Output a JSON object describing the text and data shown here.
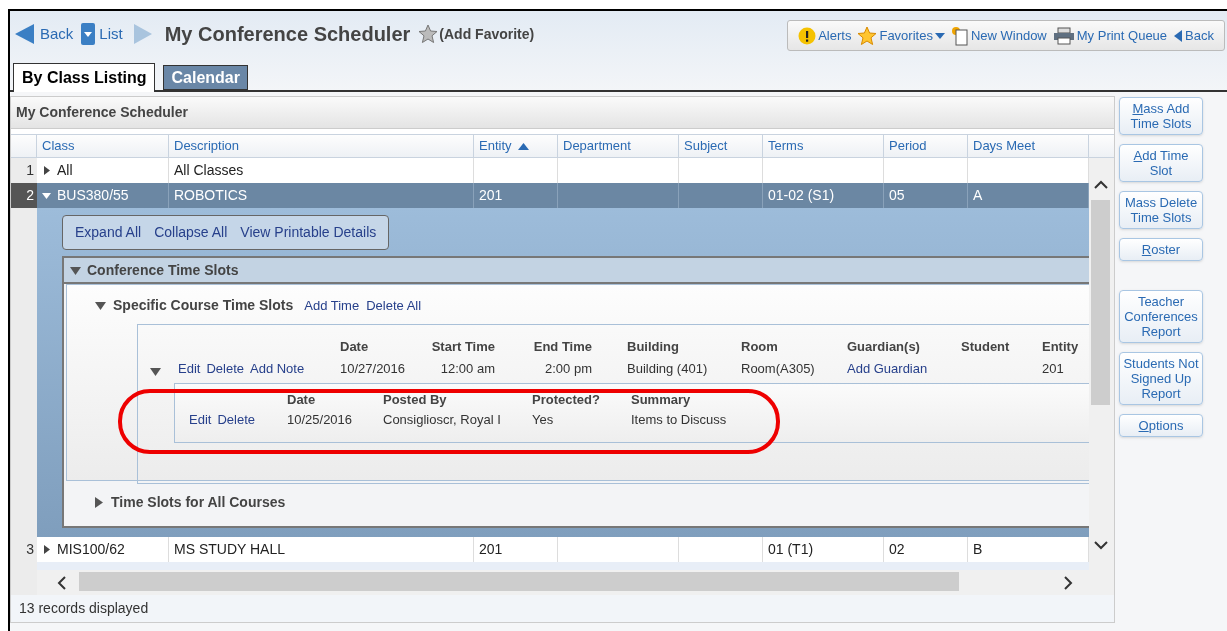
{
  "nav": {
    "back": "Back",
    "list": "List",
    "title": "My Conference Scheduler",
    "favorite": "(Add Favorite)"
  },
  "toolbar": [
    {
      "kind": "alert",
      "label": "Alerts"
    },
    {
      "kind": "favorites",
      "label": "Favorites"
    },
    {
      "kind": "new_window",
      "label": "New Window"
    },
    {
      "kind": "print",
      "label": "My Print Queue"
    },
    {
      "kind": "back",
      "label": "Back"
    }
  ],
  "tabs": [
    {
      "label": "By Class Listing",
      "selected": true
    },
    {
      "label": "Calendar",
      "selected": false
    }
  ],
  "panel_title": "My Conference Scheduler",
  "table": {
    "columns": [
      {
        "label": "Class",
        "sorted": false
      },
      {
        "label": "Description",
        "sorted": false
      },
      {
        "label": "Entity",
        "sorted": true
      },
      {
        "label": "Department",
        "sorted": false
      },
      {
        "label": "Subject",
        "sorted": false
      },
      {
        "label": "Terms",
        "sorted": false
      },
      {
        "label": "Period",
        "sorted": false
      },
      {
        "label": "Days Meet",
        "sorted": false
      }
    ],
    "rows": [
      {
        "number": "1",
        "cells": [
          "All",
          "All Classes",
          "",
          "",
          "",
          "",
          "",
          ""
        ],
        "expanded": false,
        "selected": false
      },
      {
        "number": "2",
        "cells": [
          "BUS380/55",
          "ROBOTICS",
          "201",
          "",
          "",
          "01-02 (S1)",
          "05",
          "A"
        ],
        "expanded": true,
        "selected": true
      },
      {
        "number": "3",
        "cells": [
          "MIS100/62",
          "MS STUDY HALL",
          "201",
          "",
          "",
          "01 (T1)",
          "02",
          "B"
        ],
        "expanded": false,
        "selected": false
      }
    ]
  },
  "detail": {
    "actions": [
      "Expand All",
      "Collapse All",
      "View Printable Details"
    ],
    "section": {
      "title": "Conference Time Slots",
      "expanded": true
    },
    "specific": {
      "title": "Specific Course Time Slots",
      "expanded": true,
      "links": [
        "Add Time",
        "Delete All"
      ],
      "columns": [
        "Date",
        "Start Time",
        "End Time",
        "Building",
        "Room",
        "Guardian(s)",
        "Student",
        "Entity"
      ],
      "slot": {
        "expanded": true,
        "actions": [
          "Edit",
          "Delete",
          "Add Note"
        ],
        "date": "10/27/2016",
        "start": "12:00 am",
        "end": "2:00 pm",
        "building": "Building (401)",
        "room": "Room(A305)",
        "guardian": "Add Guardian",
        "entity": "201"
      },
      "note": {
        "actions": [
          "Edit",
          "Delete"
        ],
        "columns": [
          "Date",
          "Posted By",
          "Protected?",
          "Summary"
        ],
        "values": [
          "10/25/2016",
          "Consiglioscr, Royal I",
          "Yes",
          "Items to Discuss"
        ]
      }
    },
    "all_courses": {
      "title": "Time Slots for All Courses",
      "expanded": false
    }
  },
  "side_button_groups": [
    {
      "buttons": [
        {
          "label": "Mass Add Time Slots",
          "underline_first": true
        },
        {
          "label": "Add Time Slot",
          "underline_first": true
        },
        {
          "label": "Mass Delete Time Slots",
          "underline_first": false
        },
        {
          "label": "Roster",
          "underline_first": true
        }
      ]
    },
    {
      "buttons": [
        {
          "label": "Teacher Conferences Report",
          "underline_first": false
        },
        {
          "label": "Students Not Signed Up Report",
          "underline_first": false
        },
        {
          "label": "Options",
          "underline_first": true
        }
      ]
    }
  ],
  "status": "13 records displayed"
}
